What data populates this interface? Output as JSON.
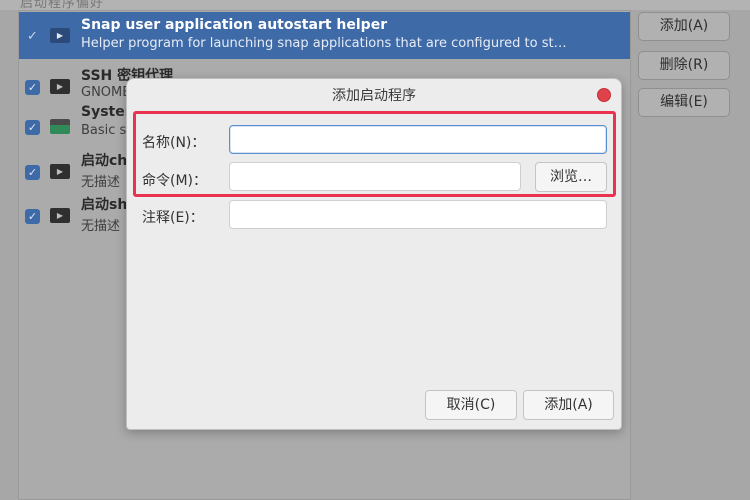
{
  "background_list": {
    "header_partial": "启动程序偏好",
    "items": [
      {
        "name": "Snap user application autostart helper",
        "desc": "Helper program for launching snap applications that are configured to st…",
        "checked": true,
        "selected": true,
        "icon": "terminal-icon"
      },
      {
        "name": "SSH 密钥代理",
        "desc": "GNOME",
        "checked": true,
        "selected": false,
        "icon": "terminal-icon"
      },
      {
        "name": "System",
        "desc": "Basic s",
        "checked": true,
        "selected": false,
        "icon": "system-monitor-icon"
      },
      {
        "name": "启动ch",
        "desc": "无描述",
        "checked": true,
        "selected": false,
        "icon": "terminal-icon"
      },
      {
        "name": "启动sh",
        "desc": "无描述",
        "checked": true,
        "selected": false,
        "icon": "terminal-icon"
      }
    ]
  },
  "side_buttons": {
    "add": "添加(A)",
    "remove": "删除(R)",
    "edit": "编辑(E)"
  },
  "dialog": {
    "title": "添加启动程序",
    "name_label": "名称(N)：",
    "name_value": "",
    "command_label": "命令(M)：",
    "command_value": "",
    "browse_button": "浏览…",
    "comment_label": "注释(E)：",
    "comment_value": "",
    "cancel_button": "取消(C)",
    "add_button": "添加(A)"
  },
  "colors": {
    "selection": "#3f6aa8",
    "highlight_box": "#e8324f",
    "close_button": "#e0424c"
  }
}
